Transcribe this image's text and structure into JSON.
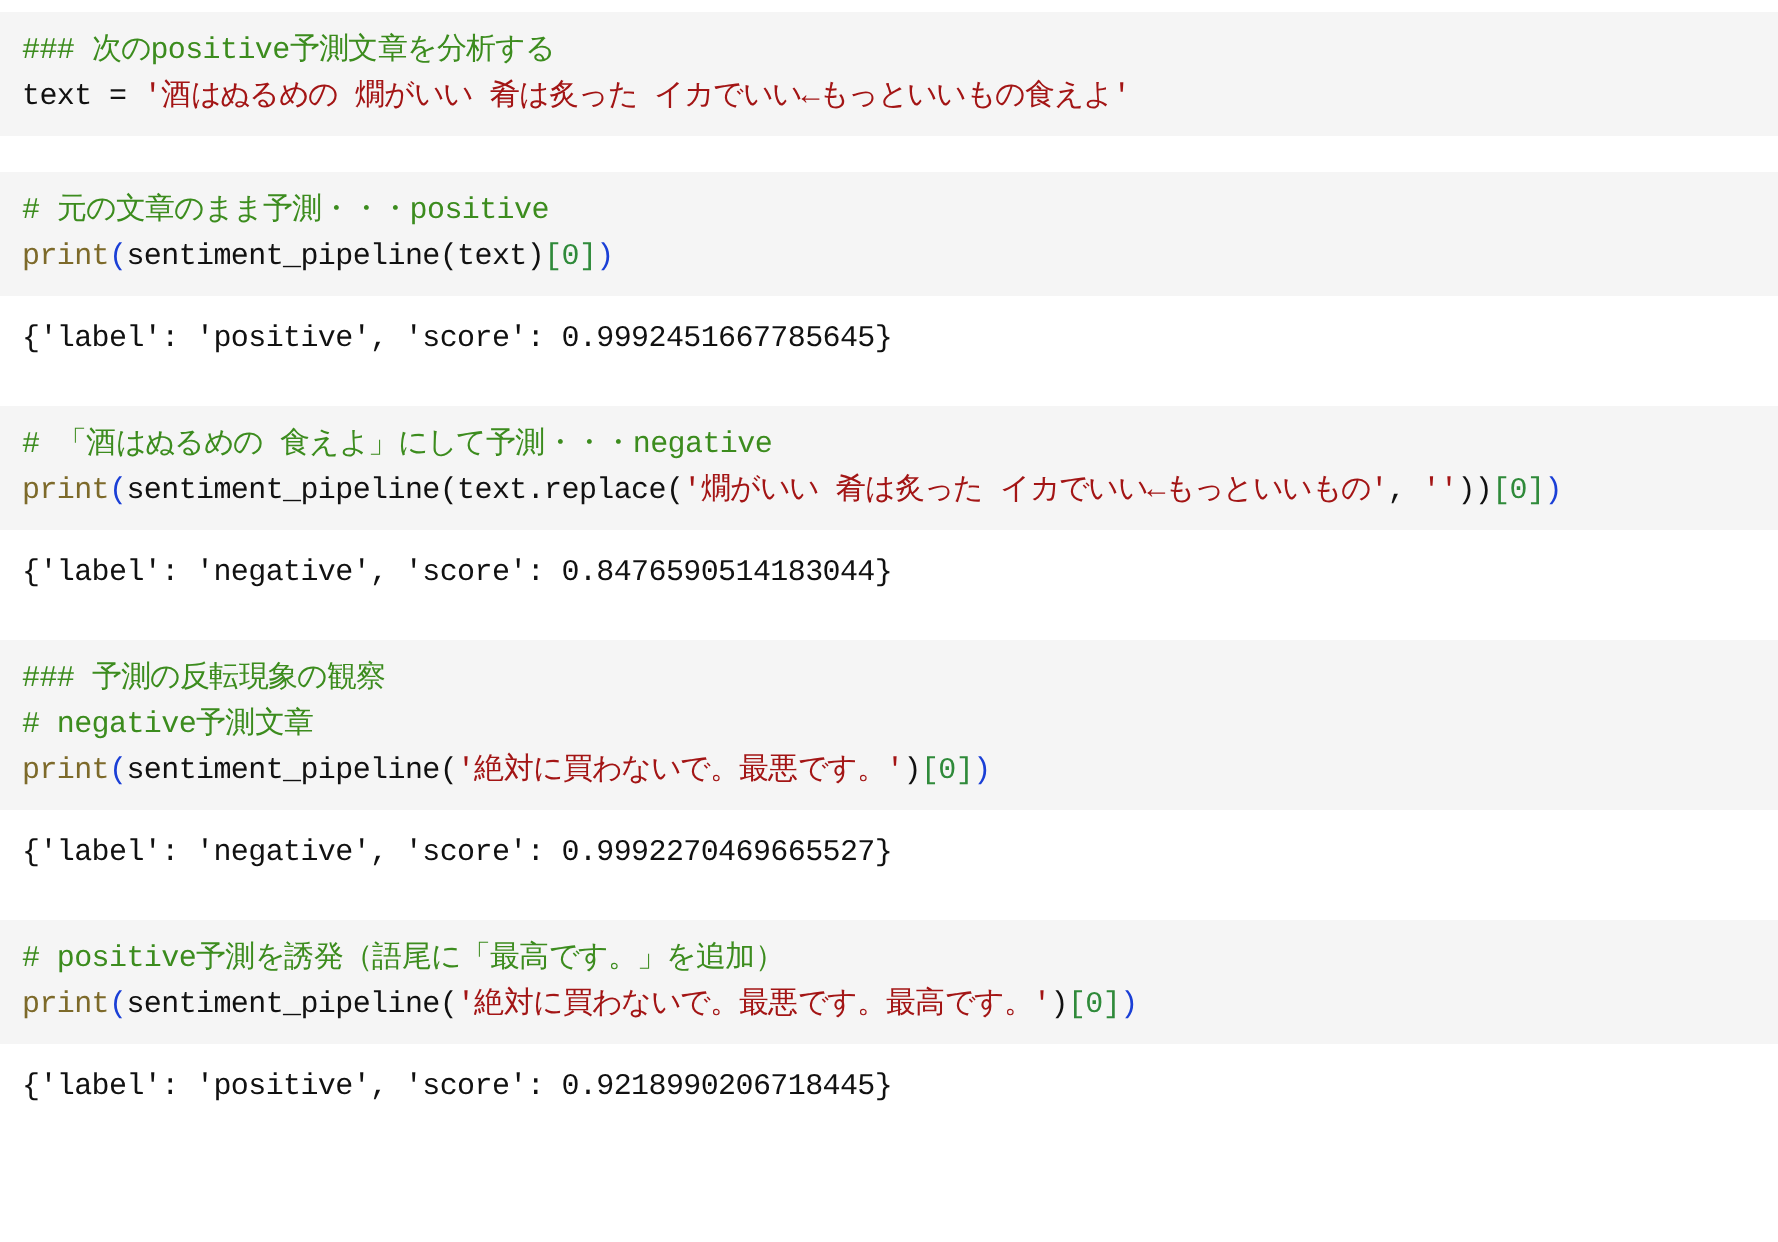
{
  "cells": [
    {
      "input": [
        [
          {
            "kind": "comment",
            "text": "### 次のpositive予測文章を分析する"
          }
        ],
        [
          {
            "kind": "plain",
            "text": "text = "
          },
          {
            "kind": "string",
            "text": "'酒はぬるめの 燗がいい 肴は炙った イカでいい←もっといいもの食えよ'"
          }
        ]
      ]
    },
    {
      "input": [
        [
          {
            "kind": "comment",
            "text": "# 元の文章のまま予測・・・positive"
          }
        ],
        [
          {
            "kind": "builtin",
            "text": "print"
          },
          {
            "kind": "paren1",
            "text": "("
          },
          {
            "kind": "plain",
            "text": "sentiment_pipeline(text)"
          },
          {
            "kind": "paren2",
            "text": "[0]"
          },
          {
            "kind": "paren1",
            "text": ")"
          }
        ]
      ],
      "output": "{'label': 'positive', 'score': 0.9992451667785645}"
    },
    {
      "input": [
        [
          {
            "kind": "comment",
            "text": "# 「酒はぬるめの 食えよ」にして予測・・・negative"
          }
        ],
        [
          {
            "kind": "builtin",
            "text": "print"
          },
          {
            "kind": "paren1",
            "text": "("
          },
          {
            "kind": "plain",
            "text": "sentiment_pipeline(text.replace("
          },
          {
            "kind": "string",
            "text": "'燗がいい 肴は炙った イカでいい←もっといいもの'"
          },
          {
            "kind": "plain",
            "text": ", "
          },
          {
            "kind": "string",
            "text": "''"
          },
          {
            "kind": "plain",
            "text": "))"
          },
          {
            "kind": "paren2",
            "text": "[0]"
          },
          {
            "kind": "paren1",
            "text": ")"
          }
        ]
      ],
      "output": "{'label': 'negative', 'score': 0.8476590514183044}"
    },
    {
      "input": [
        [
          {
            "kind": "comment",
            "text": "### 予測の反転現象の観察"
          }
        ],
        [
          {
            "kind": "comment",
            "text": "# negative予測文章"
          }
        ],
        [
          {
            "kind": "builtin",
            "text": "print"
          },
          {
            "kind": "paren1",
            "text": "("
          },
          {
            "kind": "plain",
            "text": "sentiment_pipeline("
          },
          {
            "kind": "string",
            "text": "'絶対に買わないで。最悪です。'"
          },
          {
            "kind": "plain",
            "text": ")"
          },
          {
            "kind": "paren2",
            "text": "[0]"
          },
          {
            "kind": "paren1",
            "text": ")"
          }
        ]
      ],
      "output": "{'label': 'negative', 'score': 0.9992270469665527}"
    },
    {
      "input": [
        [
          {
            "kind": "comment",
            "text": "# positive予測を誘発（語尾に「最高です。」を追加）"
          }
        ],
        [
          {
            "kind": "builtin",
            "text": "print"
          },
          {
            "kind": "paren1",
            "text": "("
          },
          {
            "kind": "plain",
            "text": "sentiment_pipeline("
          },
          {
            "kind": "string",
            "text": "'絶対に買わないで。最悪です。最高です。'"
          },
          {
            "kind": "plain",
            "text": ")"
          },
          {
            "kind": "paren2",
            "text": "[0]"
          },
          {
            "kind": "paren1",
            "text": ")"
          }
        ]
      ],
      "output": "{'label': 'positive', 'score': 0.9218990206718445}"
    }
  ]
}
